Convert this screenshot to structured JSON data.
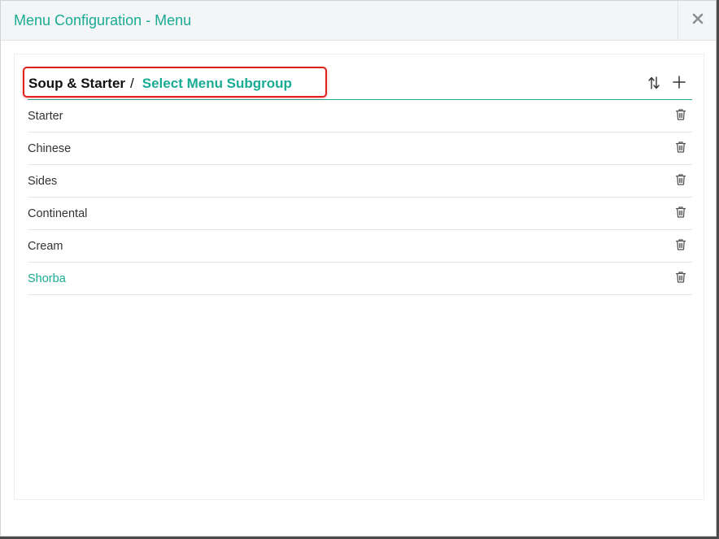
{
  "dialog": {
    "title": "Menu Configuration - Menu",
    "close_icon": "close-icon"
  },
  "breadcrumb": {
    "group": "Soup & Starter",
    "separator": "/",
    "subgroup_prompt": "Select Menu Subgroup"
  },
  "toolbar": {
    "sort_icon": "sort-arrows-icon",
    "add_icon": "plus-icon"
  },
  "subgroups": [
    {
      "label": "Starter",
      "active": false
    },
    {
      "label": "Chinese",
      "active": false
    },
    {
      "label": "Sides",
      "active": false
    },
    {
      "label": "Continental",
      "active": false
    },
    {
      "label": "Cream",
      "active": false
    },
    {
      "label": "Shorba",
      "active": true
    }
  ],
  "colors": {
    "accent": "#1aab94",
    "highlight": "#e0201b",
    "text": "#333333"
  }
}
